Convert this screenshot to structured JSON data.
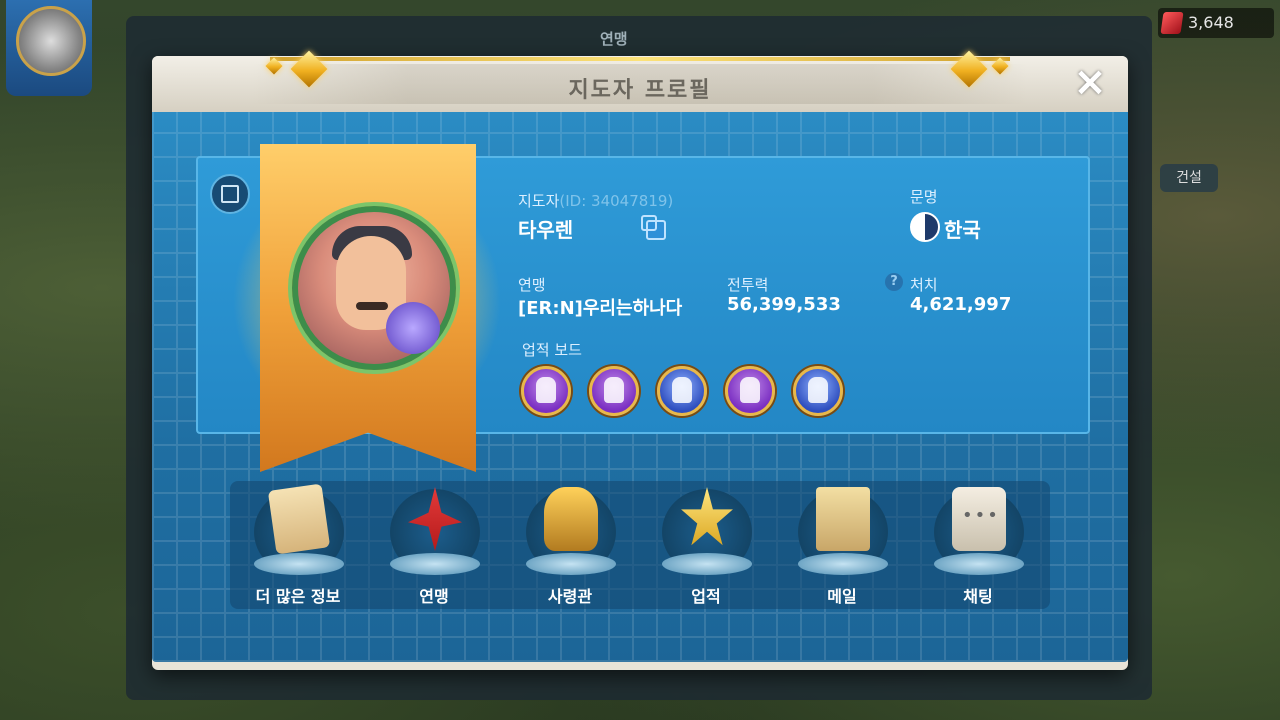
{
  "background": {
    "resource_value": "3,648",
    "side_label": "건설",
    "back_title": "연맹"
  },
  "modal": {
    "title": "지도자 프로필",
    "close_icon": "close-icon"
  },
  "profile": {
    "leader_label": "지도자",
    "leader_id": "(ID: 34047819)",
    "leader_name": "타우렌",
    "civilization_label": "문명",
    "civilization_value": "한국",
    "alliance_label": "연맹",
    "alliance_value": "[ER:N]우리는하나다",
    "power_label": "전투력",
    "power_value": "56,399,533",
    "kills_label": "처치",
    "kills_value": "4,621,997",
    "achievement_board_label": "업적 보드",
    "achievements": [
      {
        "icon": "achievement-warrior-icon",
        "color": "#7b2fc2"
      },
      {
        "icon": "achievement-spartan-icon",
        "color": "#7b2fc2"
      },
      {
        "icon": "achievement-shield-icon",
        "color": "#2f4fbf"
      },
      {
        "icon": "achievement-general-icon",
        "color": "#7b2fc2"
      },
      {
        "icon": "achievement-knight-icon",
        "color": "#2f4fbf"
      }
    ]
  },
  "actions": [
    {
      "label": "더 많은 정보",
      "icon": "scroll-icon"
    },
    {
      "label": "연맹",
      "icon": "alliance-sword-icon"
    },
    {
      "label": "사령관",
      "icon": "commander-helmet-icon"
    },
    {
      "label": "업적",
      "icon": "achievement-star-icon"
    },
    {
      "label": "메일",
      "icon": "mail-icon"
    },
    {
      "label": "채팅",
      "icon": "chat-icon"
    }
  ],
  "colors": {
    "accent_blue": "#2387c5",
    "gold": "#f0b020",
    "header_bg": "#e9e4d8"
  }
}
